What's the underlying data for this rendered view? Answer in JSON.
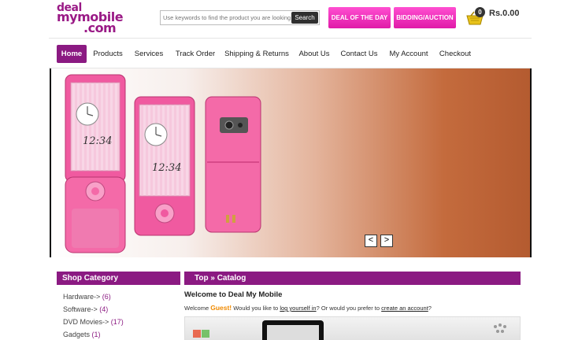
{
  "header": {
    "logo": {
      "line1": "deal",
      "line2": "mymobile",
      "line3": ".com"
    },
    "search": {
      "placeholder": "Use keywords to find the product you are looking",
      "button_label": "Search"
    },
    "deal_button": "DEAL OF THE DAY",
    "bidding_button": "BIDDING/AUCTION",
    "cart": {
      "count": "0",
      "total": "Rs.0.00"
    }
  },
  "nav": {
    "items": [
      "Home",
      "Products",
      "Services",
      "Track Order",
      "Shipping & Returns",
      "About Us",
      "Contact Us",
      "My Account",
      "Checkout"
    ],
    "active": "Home"
  },
  "banner": {
    "prev_label": "<",
    "next_label": ">",
    "clock_text": "12:34"
  },
  "sidebar": {
    "title": "Shop Category",
    "items": [
      {
        "label": "Hardware->",
        "count": "(6)"
      },
      {
        "label": "Software->",
        "count": "(4)"
      },
      {
        "label": "DVD Movies->",
        "count": "(17)"
      },
      {
        "label": "Gadgets",
        "count": "(1)"
      }
    ]
  },
  "main": {
    "breadcrumb": "Top » Catalog",
    "welcome_title": "Welcome to Deal My Mobile",
    "welcome_prefix": "Welcome",
    "guest": "Guest!",
    "text_mid": "Would you like to",
    "login_link": "log yourself in",
    "text_or": "? Or would you prefer to",
    "create_link": "create an account",
    "text_end": "?"
  },
  "colors": {
    "brand_purple": "#8b1a82",
    "accent_pink": "#e01aa8",
    "guest_orange": "#f08a00"
  }
}
